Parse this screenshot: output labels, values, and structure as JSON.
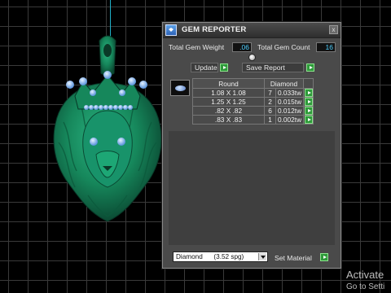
{
  "window": {
    "title": "GEM REPORTER",
    "close_glyph": "x"
  },
  "summary": {
    "total_weight_label": "Total Gem Weight",
    "total_weight_value": ".06",
    "total_count_label": "Total Gem Count",
    "total_count_value": "16"
  },
  "actions": {
    "update_label": "Update",
    "save_report_label": "Save Report",
    "set_material_label": "Set Material"
  },
  "table": {
    "headers": [
      "Round",
      "Diamond"
    ],
    "rows": [
      {
        "size": "1.08 X 1.08",
        "count": "7",
        "weight": "0.033tw"
      },
      {
        "size": "1.25 X 1.25",
        "count": "2",
        "weight": "0.015tw"
      },
      {
        "size": ".82 X .82",
        "count": "6",
        "weight": "0.012tw"
      },
      {
        "size": ".83 X .83",
        "count": "1",
        "weight": "0.002tw"
      }
    ]
  },
  "material": {
    "selected": "Diamond      (3.52 spg)"
  },
  "watermark": {
    "line1": "Activate",
    "line2": "Go to Setti"
  },
  "colors": {
    "panel_bg": "#4a4a4a",
    "value_text": "#4fd0ff",
    "go_button": "#2e9a3a",
    "pendant_green": "#1a8a5e",
    "gem_blue": "#7fb8f0"
  },
  "icons": {
    "app": "gem-reporter-app-icon",
    "go": "green-play-arrow-icon",
    "expand": "round-knob-icon",
    "gem_preview": "round-diamond-icon",
    "dropdown": "chevron-down-icon"
  }
}
